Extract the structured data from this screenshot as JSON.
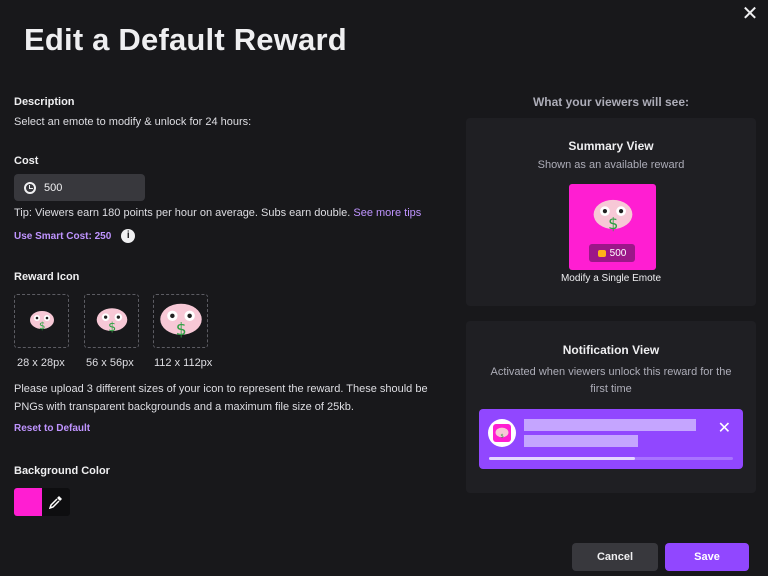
{
  "dialog": {
    "title": "Edit a Default Reward",
    "close_icon": "close-icon"
  },
  "description": {
    "label": "Description",
    "text": "Select an emote to modify & unlock for 24 hours:"
  },
  "cost": {
    "label": "Cost",
    "value": "500",
    "icon": "channel-points-icon",
    "tip_prefix": "Tip: Viewers earn 180 points per hour on average. Subs earn double.",
    "tip_link": "See more tips",
    "smart_cost": "Use Smart Cost: 250"
  },
  "reward_icon": {
    "label": "Reward Icon",
    "sizes": [
      "28 x 28px",
      "56 x 56px",
      "112 x 112px"
    ],
    "upload_text": "Please upload 3 different sizes of your icon to represent the reward. These should be PNGs with transparent backgrounds and a maximum file size of 25kb.",
    "reset_link": "Reset to Default"
  },
  "background": {
    "label": "Background Color",
    "color": "#ff1ed2",
    "eyedropper_icon": "eyedropper-icon"
  },
  "preview": {
    "heading": "What your viewers will see:",
    "summary": {
      "title": "Summary View",
      "subtitle": "Shown as an available reward",
      "cost": "500",
      "reward_name": "Modify a Single Emote"
    },
    "notification": {
      "title": "Notification View",
      "subtitle": "Activated when viewers unlock this reward for the first time",
      "progress": 0.6
    }
  },
  "footer": {
    "cancel_label": "Cancel",
    "save_label": "Save"
  },
  "colors": {
    "accent": "#9147ff",
    "link": "#bf94ff",
    "reward_bg": "#ff1ed2"
  }
}
